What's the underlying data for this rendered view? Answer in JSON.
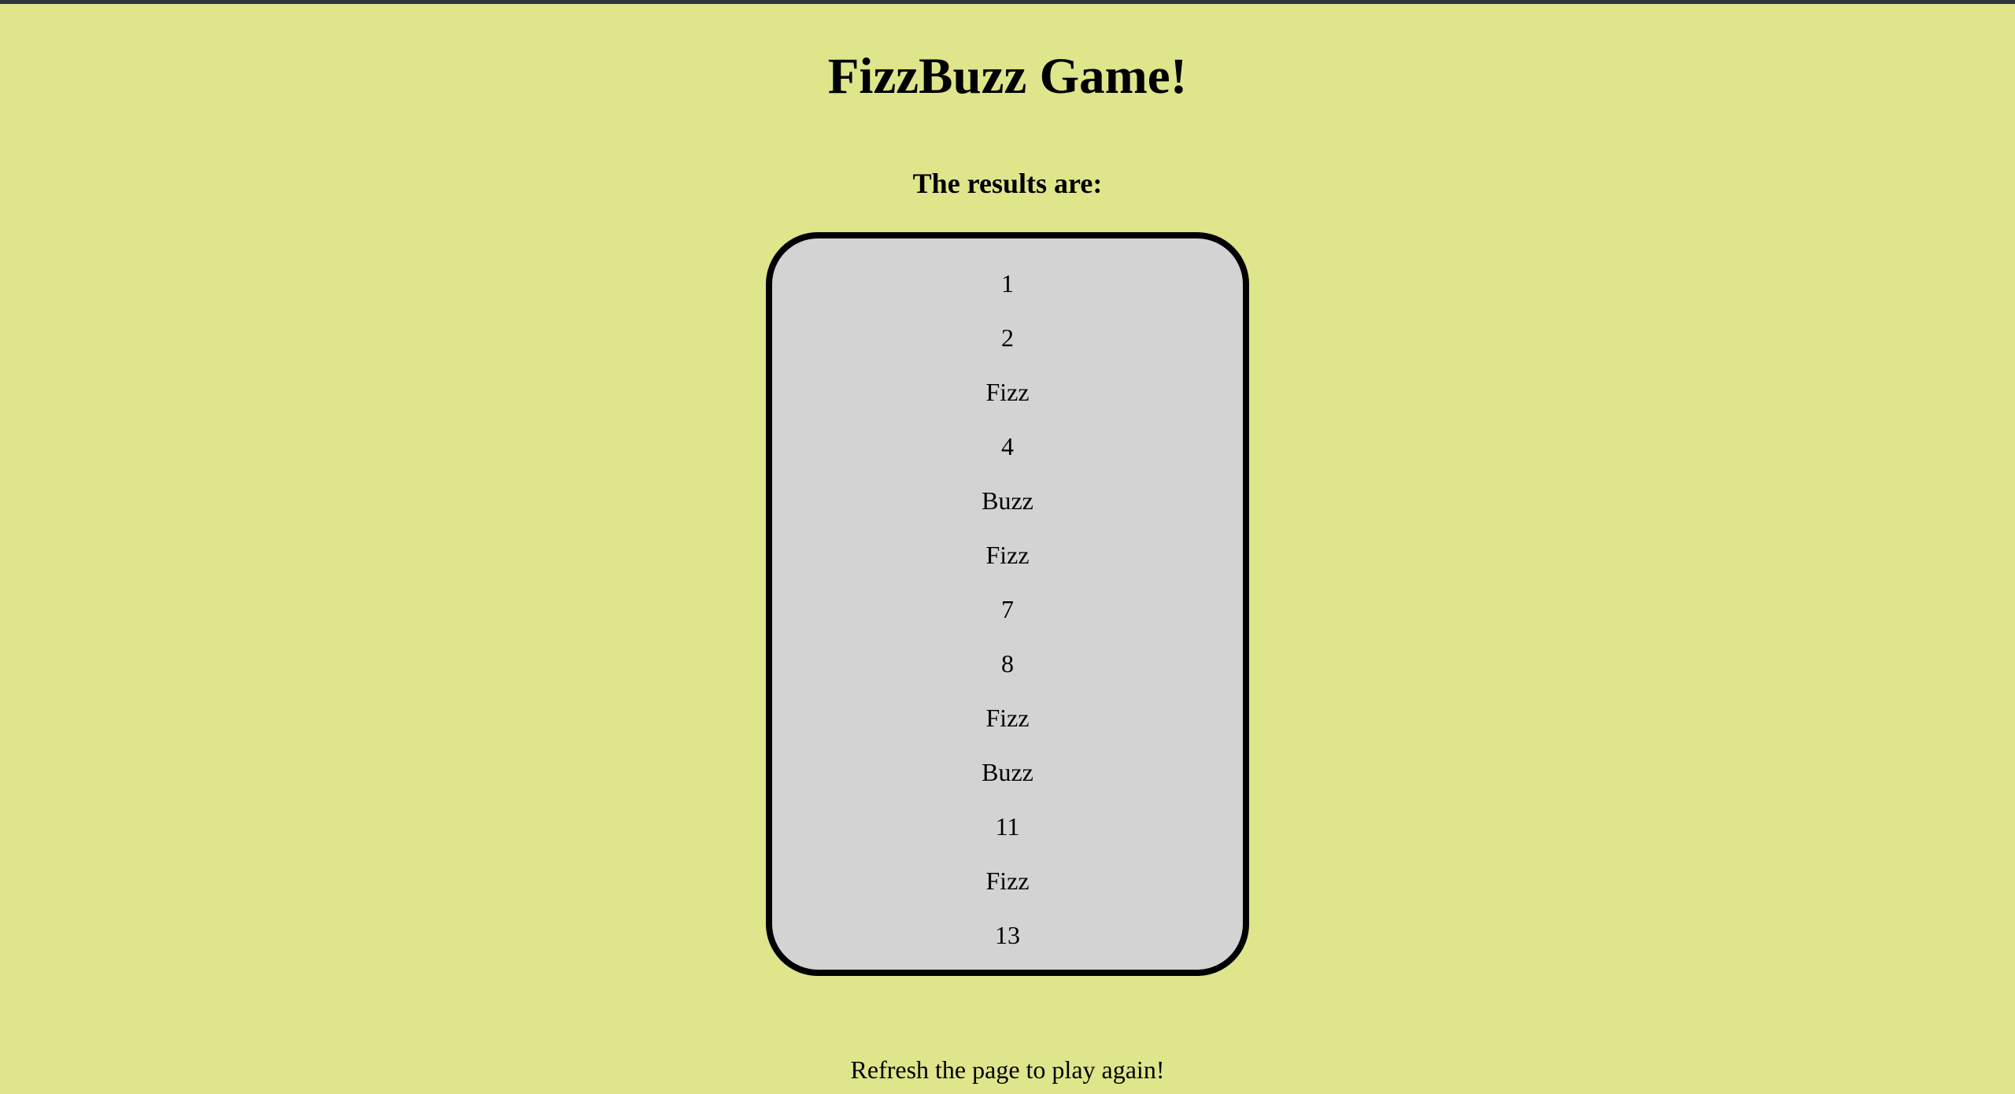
{
  "page": {
    "title": "FizzBuzz Game!",
    "subtitle": "The results are:",
    "footer": "Refresh the page to play again!"
  },
  "results": [
    "1",
    "2",
    "Fizz",
    "4",
    "Buzz",
    "Fizz",
    "7",
    "8",
    "Fizz",
    "Buzz",
    "11",
    "Fizz",
    "13"
  ],
  "colors": {
    "background": "#dfe58a",
    "box_background": "#d3d3d3",
    "box_border": "#000000",
    "text": "#000000"
  }
}
